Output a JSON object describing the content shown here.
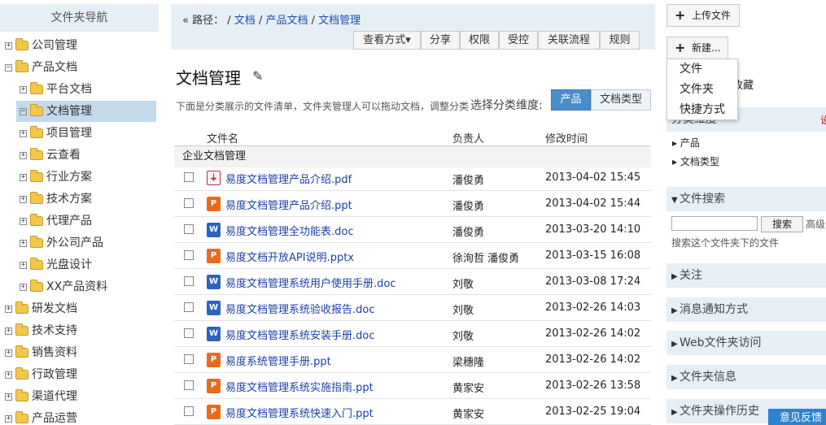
{
  "tree": {
    "header": "文件夹导航",
    "items": [
      {
        "toggle": "+",
        "label": "公司管理"
      },
      {
        "toggle": "−",
        "label": "产品文档"
      },
      {
        "toggle": "+",
        "label": "平台文档"
      },
      {
        "toggle": "−",
        "label": "文档管理"
      },
      {
        "toggle": "+",
        "label": "项目管理"
      },
      {
        "toggle": "+",
        "label": "云查看"
      },
      {
        "toggle": "+",
        "label": "行业方案"
      },
      {
        "toggle": "+",
        "label": "技术方案"
      },
      {
        "toggle": "+",
        "label": "代理产品"
      },
      {
        "toggle": "+",
        "label": "外公司产品"
      },
      {
        "toggle": "+",
        "label": "光盘设计"
      },
      {
        "toggle": "+",
        "label": "XX产品资料"
      },
      {
        "toggle": "+",
        "label": "研发文档"
      },
      {
        "toggle": "+",
        "label": "技术支持"
      },
      {
        "toggle": "+",
        "label": "销售资料"
      },
      {
        "toggle": "+",
        "label": "行政管理"
      },
      {
        "toggle": "+",
        "label": "渠道代理"
      },
      {
        "toggle": "+",
        "label": "产品运营"
      }
    ]
  },
  "path": {
    "collapse": "«",
    "label": "路径：",
    "sep": "/",
    "crumbs": [
      "文档",
      "产品文档",
      "文档管理"
    ]
  },
  "toolbar": [
    "查看方式▾",
    "分享",
    "权限",
    "受控",
    "关联流程",
    "规则"
  ],
  "doc": {
    "title": "文档管理",
    "edit_icon": "pencil-icon",
    "description": "下面是分类展示的文件清单，文件夹管理人可以拖动文档，调整分类",
    "dimension_label": "选择分类维度:",
    "dimensions": [
      "产品",
      "文档类型"
    ]
  },
  "table": {
    "headers": [
      "文件名",
      "负责人",
      "修改时间"
    ],
    "group": "企业文档管理",
    "rows": [
      {
        "type": "pdf",
        "name": "易度文档管理产品介绍.pdf",
        "owner": "潘俊勇",
        "time": "2013-04-02 15:45"
      },
      {
        "type": "ppt",
        "name": "易度文档管理产品介绍.ppt",
        "owner": "潘俊勇",
        "time": "2013-04-02 15:44"
      },
      {
        "type": "doc",
        "name": "易度文档管理全功能表.doc",
        "owner": "潘俊勇",
        "time": "2013-03-20 14:10"
      },
      {
        "type": "ppt",
        "name": "易度文档开放API说明.pptx",
        "owner": "徐洵哲 潘俊勇",
        "time": "2013-03-15 16:08"
      },
      {
        "type": "doc",
        "name": "易度文档管理系统用户使用手册.doc",
        "owner": "刘敬",
        "time": "2013-03-08 17:24"
      },
      {
        "type": "doc",
        "name": "易度文档管理系统验收报告.doc",
        "owner": "刘敬",
        "time": "2013-02-26 14:03"
      },
      {
        "type": "doc",
        "name": "易度文档管理系统安装手册.doc",
        "owner": "刘敬",
        "time": "2013-02-26 14:02"
      },
      {
        "type": "ppt",
        "name": "易度系统管理手册.ppt",
        "owner": "梁穗隆",
        "time": "2013-02-26 14:02"
      },
      {
        "type": "ppt",
        "name": "易度文档管理系统实施指南.ppt",
        "owner": "黄家安",
        "time": "2013-02-26 13:58"
      },
      {
        "type": "ppt",
        "name": "易度文档管理系统快速入门.ppt",
        "owner": "黄家安",
        "time": "2013-02-25 19:04"
      }
    ]
  },
  "right": {
    "upload": "上传文件",
    "new": "新建...",
    "favorite": "收藏",
    "new_menu": [
      "文件",
      "文件夹",
      "快捷方式"
    ],
    "classify_panel": "分类维度",
    "classify_items": [
      "产品",
      "文档类型"
    ],
    "search_panel": "文件搜索",
    "search_button": "搜索",
    "advanced": "高级",
    "search_hint": "搜索这个文件夹下的文件",
    "panels": [
      "关注",
      "消息通知方式",
      "Web文件夹访问",
      "文件夹信息",
      "文件夹操作历史"
    ],
    "feedback": "意见反馈",
    "red_mark": "设"
  }
}
